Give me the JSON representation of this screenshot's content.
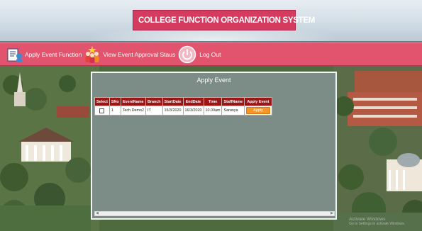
{
  "header": {
    "title": "COLLEGE FUNCTION ORGANIZATION SYSTEM",
    "logo_icon": "college-building-icon"
  },
  "nav": {
    "items": [
      {
        "label": "Apply Event Function",
        "icon": "apply-event-icon"
      },
      {
        "label": "View Event Approval Staus",
        "icon": "people-approval-icon"
      },
      {
        "label": "Log Out",
        "icon": "power-icon"
      }
    ]
  },
  "panel": {
    "title": "Apply Event",
    "columns": [
      "Select",
      "SNo",
      "EventName",
      "Branch",
      "StartDate",
      "EndDate",
      "Time",
      "StaffName",
      "Apply Event"
    ],
    "rows": [
      {
        "sno": "1",
        "event_name": "Tech Demo2",
        "branch": "IT",
        "start_date": "15/3/2020",
        "end_date": "16/3/2020",
        "time": "10.00am",
        "staff_name": "Saranya",
        "action": "Apply"
      }
    ]
  },
  "watermark": {
    "line1": "Activate Windows",
    "line2": "Go to Settings to activate Windows."
  },
  "colors": {
    "brand": "#d33c5f",
    "nav": "#e2546e",
    "panel": "#7c8c86",
    "grid_header": "#9b1616",
    "apply_button": "#f5962a"
  }
}
